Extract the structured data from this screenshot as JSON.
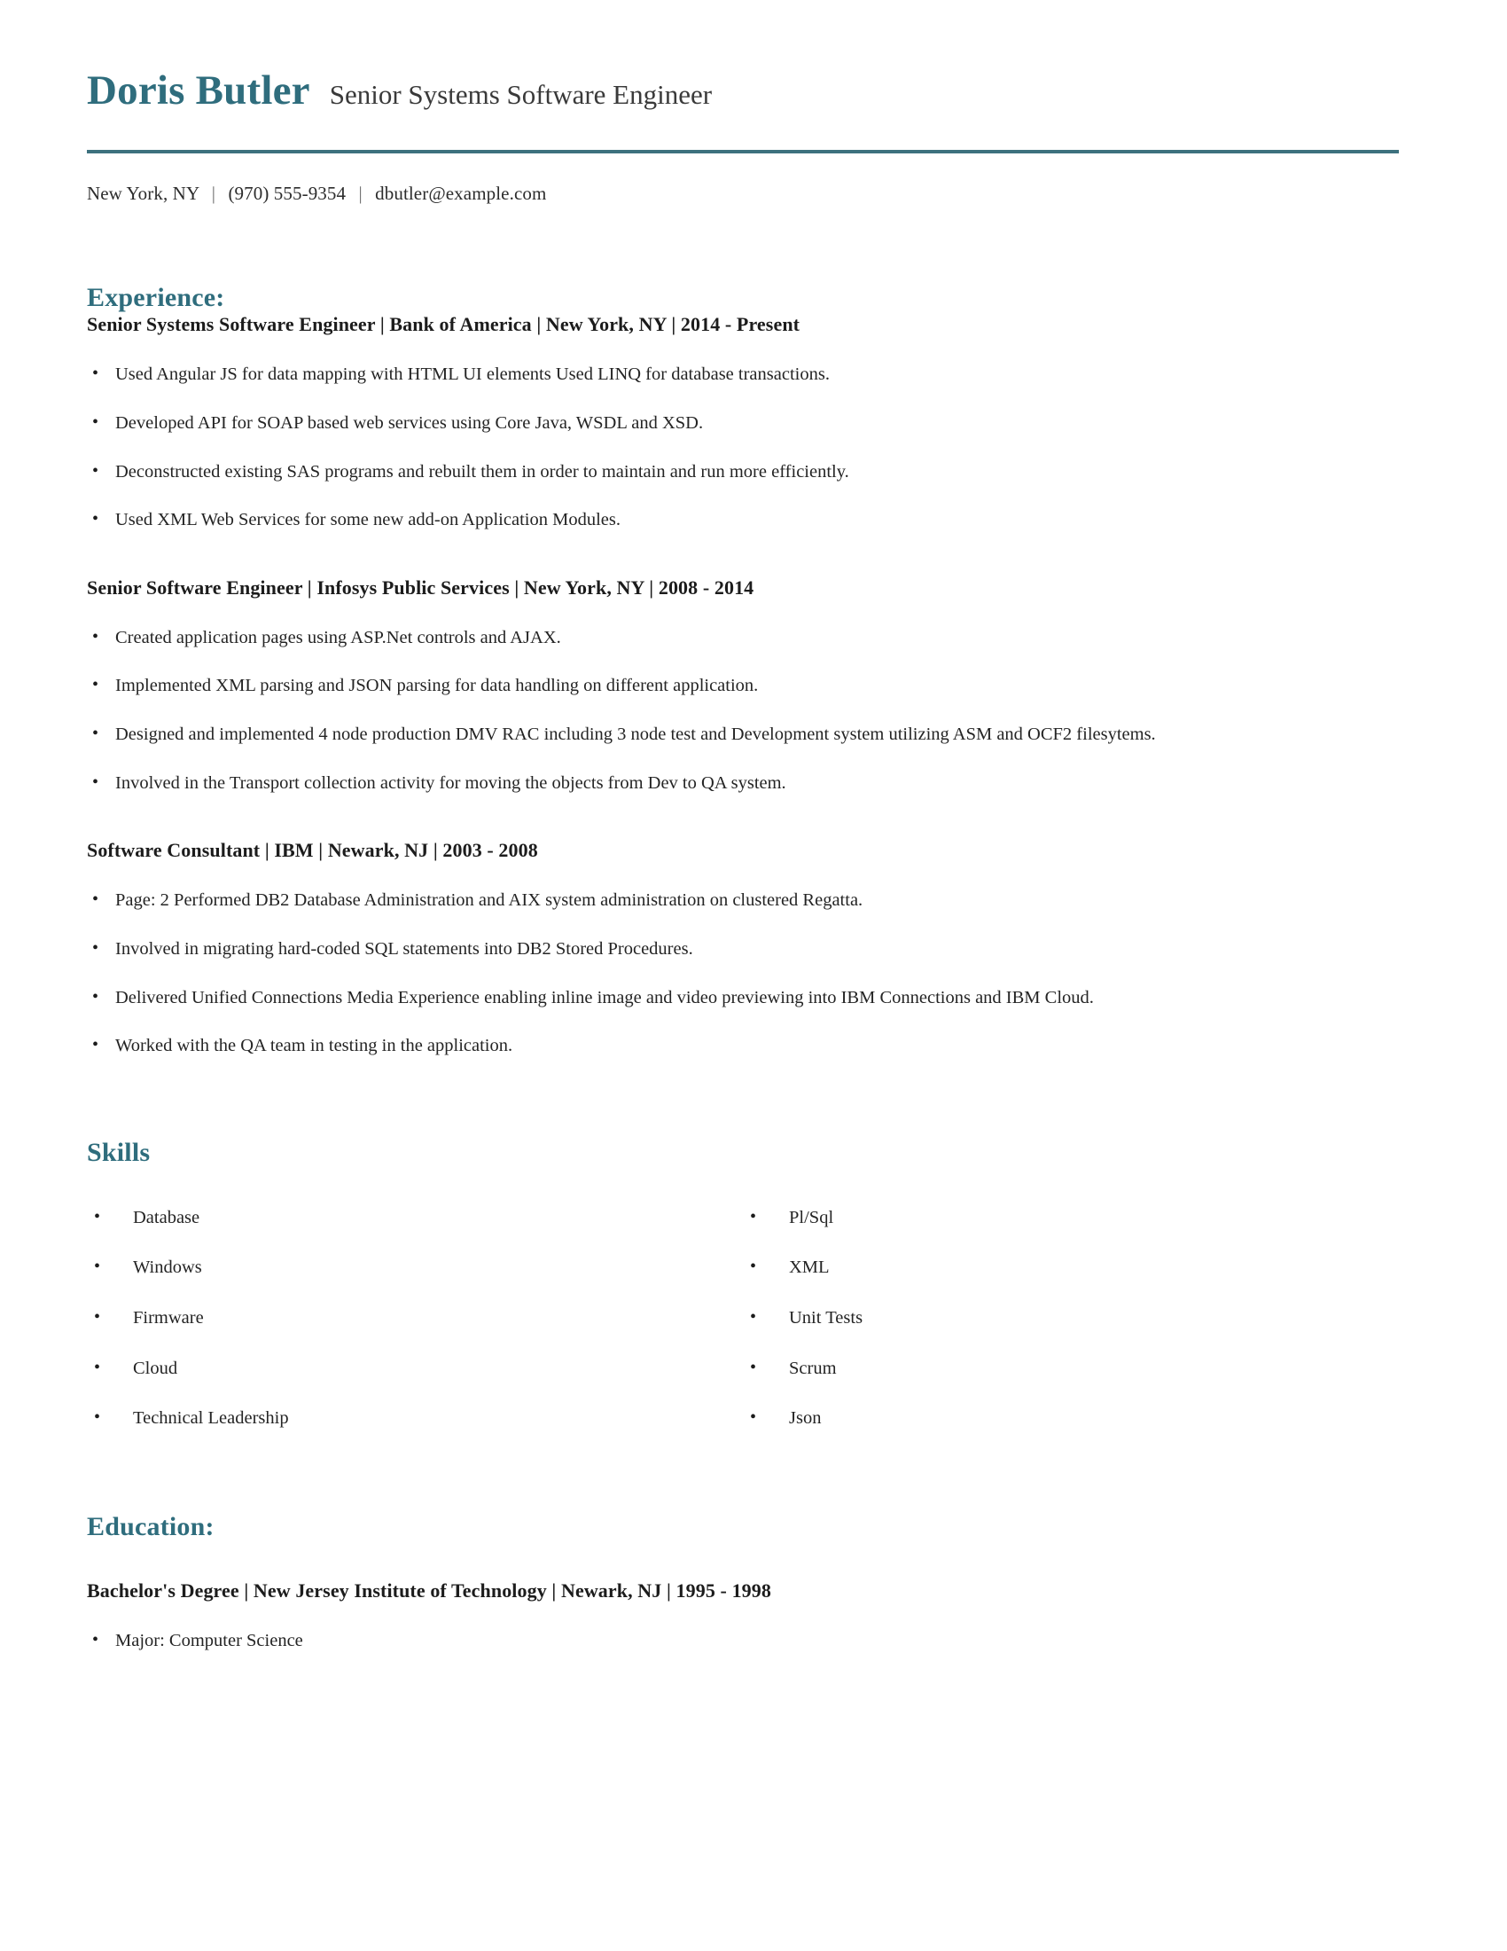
{
  "header": {
    "name": "Doris Butler",
    "job_title": "Senior Systems Software Engineer",
    "contact": {
      "location": "New York, NY",
      "separator": "|",
      "phone": "(970) 555-9354",
      "email": "dbutler@example.com"
    }
  },
  "theme": {
    "accent": "#2f6d7d",
    "rule": "#3d717e",
    "text": "#242424"
  },
  "sections": {
    "experience": {
      "heading": "Experience:",
      "entries": [
        {
          "title": "Senior Systems Software Engineer | Bank of America | New York, NY | 2014 - Present",
          "bullets": [
            "Used Angular JS for data mapping with HTML UI elements Used LINQ for database transactions.",
            "Developed API for SOAP based web services using Core Java, WSDL and XSD.",
            "Deconstructed existing SAS programs and rebuilt them in order to maintain and run more efficiently.",
            "Used XML Web Services for some new add-on Application Modules."
          ]
        },
        {
          "title": "Senior Software Engineer | Infosys Public Services | New York, NY | 2008 - 2014",
          "bullets": [
            "Created application pages using ASP.Net controls and AJAX.",
            "Implemented XML parsing and JSON parsing for data handling on different application.",
            "Designed and implemented 4 node production DMV RAC including 3 node test and Development system utilizing ASM and OCF2 filesytems.",
            "Involved in the Transport collection activity for moving the objects from Dev to QA system."
          ]
        },
        {
          "title": "Software Consultant | IBM | Newark, NJ | 2003 - 2008",
          "bullets": [
            "Page: 2 Performed DB2 Database Administration and AIX system administration on clustered Regatta.",
            "Involved in migrating hard-coded SQL statements into DB2 Stored Procedures.",
            "Delivered Unified Connections Media Experience enabling inline image and video previewing into IBM Connections and IBM Cloud.",
            "Worked with the QA team in testing in the application."
          ]
        }
      ]
    },
    "skills": {
      "heading": "Skills",
      "column_left": [
        "Database",
        "Windows",
        "Firmware",
        "Cloud",
        "Technical Leadership"
      ],
      "column_right": [
        "Pl/Sql",
        "XML",
        "Unit Tests",
        "Scrum",
        "Json"
      ]
    },
    "education": {
      "heading": "Education:",
      "entries": [
        {
          "title": "Bachelor's Degree | New Jersey Institute of Technology | Newark, NJ | 1995 - 1998",
          "bullets": [
            "Major: Computer Science"
          ]
        }
      ]
    }
  }
}
